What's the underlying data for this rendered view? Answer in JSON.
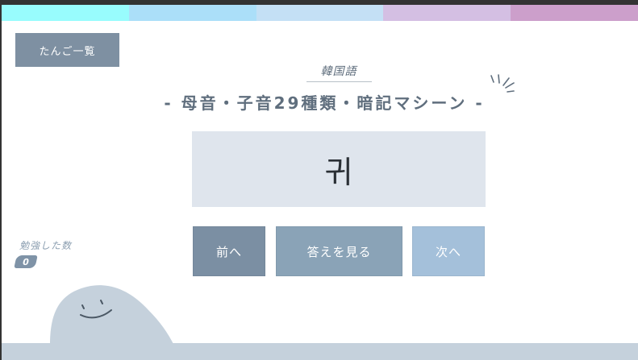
{
  "colors": {
    "stripes": [
      "#98fcfd",
      "#abdff9",
      "#c4e0f5",
      "#d4bfe3",
      "#cc9fcb"
    ],
    "page_bg": "#ffffff",
    "ground": "#c5d1dc",
    "card_bg": "#dfe5ed"
  },
  "header": {
    "list_button_label": "たんご一覧",
    "subtitle": "韓国語",
    "title": "- 母音・子音29種類・暗記マシーン -"
  },
  "card": {
    "character": "귀"
  },
  "controls": {
    "prev_label": "前へ",
    "answer_label": "答えを見る",
    "next_label": "次へ"
  },
  "stats": {
    "studied_label": "勉強した数",
    "studied_count": "0"
  },
  "icons": {
    "sparkle": "sparkle-lines-icon",
    "mascot": "blob-mascot-icon"
  }
}
